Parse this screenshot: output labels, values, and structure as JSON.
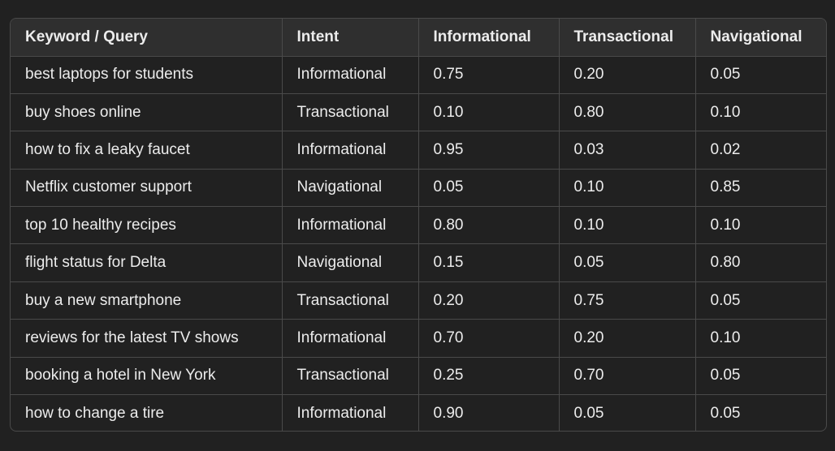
{
  "table": {
    "headers": [
      "Keyword / Query",
      "Intent",
      "Informational",
      "Transactional",
      "Navigational"
    ],
    "rows": [
      [
        "best laptops for students",
        "Informational",
        "0.75",
        "0.20",
        "0.05"
      ],
      [
        "buy shoes online",
        "Transactional",
        "0.10",
        "0.80",
        "0.10"
      ],
      [
        "how to fix a leaky faucet",
        "Informational",
        "0.95",
        "0.03",
        "0.02"
      ],
      [
        "Netflix customer support",
        "Navigational",
        "0.05",
        "0.10",
        "0.85"
      ],
      [
        "top 10 healthy recipes",
        "Informational",
        "0.80",
        "0.10",
        "0.10"
      ],
      [
        "flight status for Delta",
        "Navigational",
        "0.15",
        "0.05",
        "0.80"
      ],
      [
        "buy a new smartphone",
        "Transactional",
        "0.20",
        "0.75",
        "0.05"
      ],
      [
        "reviews for the latest TV shows",
        "Informational",
        "0.70",
        "0.20",
        "0.10"
      ],
      [
        "booking a hotel in New York",
        "Transactional",
        "0.25",
        "0.70",
        "0.05"
      ],
      [
        "how to change a tire",
        "Informational",
        "0.90",
        "0.05",
        "0.05"
      ]
    ]
  },
  "colors": {
    "background": "#212121",
    "header_background": "#2f2f2f",
    "border": "#4a4a4a",
    "text": "#ececec"
  }
}
